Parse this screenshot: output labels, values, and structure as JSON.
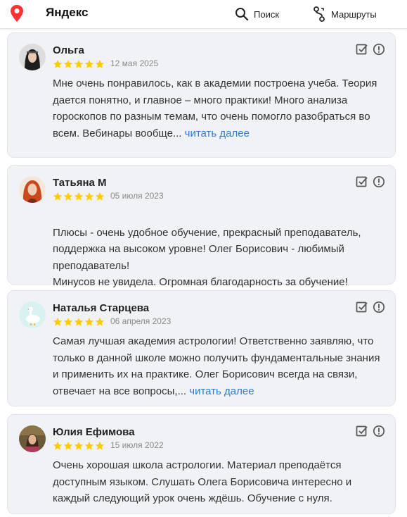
{
  "header": {
    "brand": "Яндекс",
    "search_label": "Поиск",
    "routes_label": "Маршруты",
    "accent": "#f33"
  },
  "colors": {
    "star": "#fc0",
    "link": "#2a7dd3",
    "card_bg": "#f1f2f5"
  },
  "reviews": [
    {
      "name": "Ольга",
      "rating": 5,
      "date": "12 мая 2025",
      "text": "Мне очень понравилось, как в академии построена учеба. Теория дается понятно, и главное – много практики! Много анализа гороскопов по разным темам, что очень помогло разобраться во всем. Вебинары вообще...",
      "more": "читать далее"
    },
    {
      "name": "Татьяна М",
      "rating": 5,
      "date": "05 июля 2023",
      "text": "Плюсы - очень удобное обучение, прекрасный преподаватель, поддержка на высоком уровне! Олег Борисович - любимый преподаватель!\nМинусов не увидела. Огромная благодарность за обучение!",
      "more": ""
    },
    {
      "name": "Наталья Старцева",
      "rating": 5,
      "date": "06 апреля 2023",
      "text": "Самая лучшая академия астрологии! Ответственно заявляю, что только в данной школе можно получить фундаментальные знания и применить их на практике. Олег Борисович всегда на связи, отвечает на все вопросы,...",
      "more": "читать далее"
    },
    {
      "name": "Юлия Ефимова",
      "rating": 5,
      "date": "15 июля 2022",
      "text": "Очень хорошая школа астрологии. Материал преподаётся доступным языком. Слушать Олега Борисовича интересно и каждый следующий урок очень ждёшь. Обучение с нуля.",
      "more": ""
    }
  ]
}
